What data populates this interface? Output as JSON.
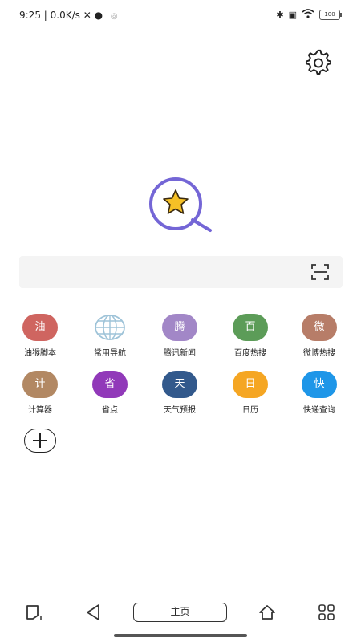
{
  "status_bar": {
    "time": "9:25",
    "network_speed": "0.0K/s",
    "battery": "100"
  },
  "search": {
    "placeholder": ""
  },
  "apps": [
    {
      "label": "油猴脚本",
      "glyph": "油",
      "color": "#cf6560",
      "icon": "app-icon"
    },
    {
      "label": "常用导航",
      "glyph": "",
      "color": "#9ec3d8",
      "icon": "globe-icon"
    },
    {
      "label": "腾讯新闻",
      "glyph": "腾",
      "color": "#a287c7",
      "icon": "app-icon"
    },
    {
      "label": "百度热搜",
      "glyph": "百",
      "color": "#5c9c58",
      "icon": "app-icon"
    },
    {
      "label": "微博热搜",
      "glyph": "微",
      "color": "#b77d68",
      "icon": "app-icon"
    },
    {
      "label": "计算器",
      "glyph": "计",
      "color": "#b28863",
      "icon": "app-icon"
    },
    {
      "label": "省点",
      "glyph": "省",
      "color": "#9139b9",
      "icon": "app-icon"
    },
    {
      "label": "天气预报",
      "glyph": "天",
      "color": "#32598c",
      "icon": "app-icon"
    },
    {
      "label": "日历",
      "glyph": "日",
      "color": "#f5a623",
      "icon": "app-icon"
    },
    {
      "label": "快递查询",
      "glyph": "快",
      "color": "#1e96e8",
      "icon": "app-icon"
    }
  ],
  "bottom_nav": {
    "home_label": "主页"
  },
  "colors": {
    "logo_ring": "#7466d6",
    "logo_star": "#f5c026"
  }
}
